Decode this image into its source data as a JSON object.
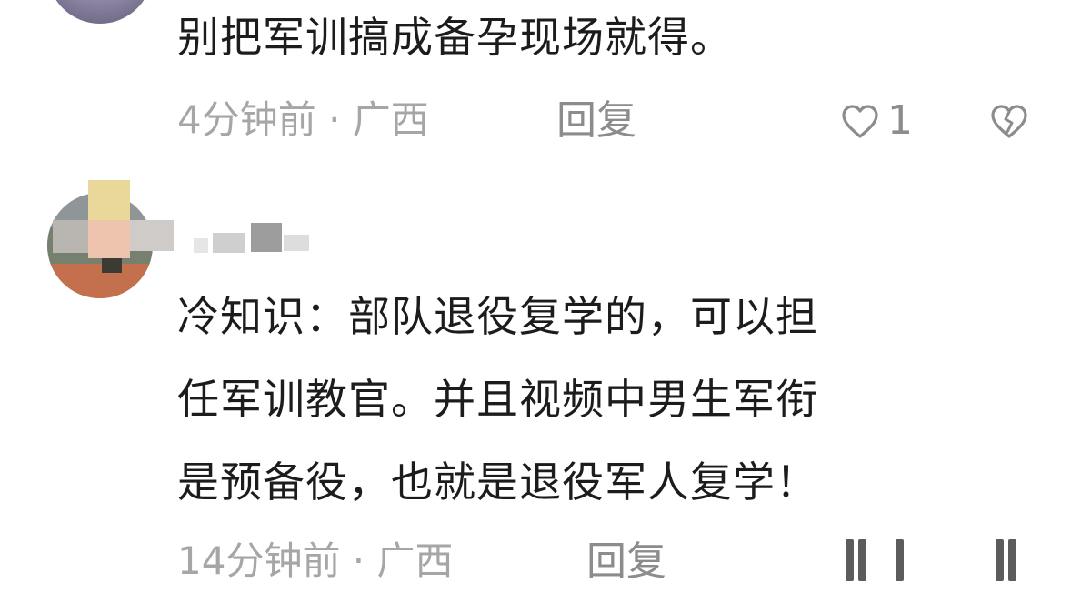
{
  "comments": [
    {
      "text": "别把军训搞成备孕现场就得。",
      "meta": "4分钟前 · 广西",
      "reply_label": "回复",
      "like_count": "1",
      "icons": [
        "heart-outline-icon",
        "broken-heart-icon"
      ]
    },
    {
      "text_lines": [
        "冷知识：部队退役复学的，可以担",
        "任军训教官。并且视频中男生军衔",
        "是预备役，也就是退役军人复学！"
      ],
      "meta": "14分钟前 · 广西",
      "reply_label": "回复",
      "icons": [
        "bars-icon",
        "bars-icon"
      ]
    }
  ],
  "colors": {
    "text": "#1c1c1c",
    "meta": "#a6a6a6",
    "action": "#8c8c8c"
  }
}
